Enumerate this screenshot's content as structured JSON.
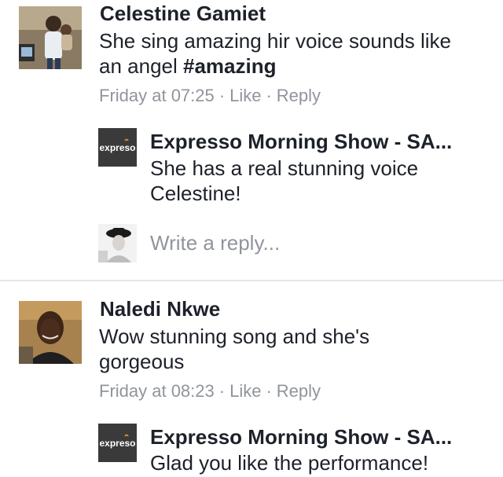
{
  "comments": [
    {
      "author": "Celestine Gamiet",
      "text_plain": "She sing amazing hir voice sounds like an angel ",
      "hashtag": "#amazing",
      "time": "Friday at 07:25",
      "like_label": "Like",
      "reply_label": "Reply",
      "reply": {
        "author": "Expresso Morning Show - SA...",
        "text": "She has a real stunning voice Celestine!",
        "avatar_logo_text": "expresso"
      },
      "write_reply_placeholder": "Write a reply..."
    },
    {
      "author": "Naledi Nkwe",
      "text_plain": "Wow stunning song and she's gorgeous",
      "time": "Friday at 08:23",
      "like_label": "Like",
      "reply_label": "Reply",
      "reply": {
        "author": "Expresso Morning Show - SA...",
        "text": "Glad you like the performance!",
        "avatar_logo_text": "expresso"
      }
    }
  ],
  "separator": "·",
  "colors": {
    "text": "#1d2129",
    "meta": "#90949c",
    "divider": "#e5e6e9",
    "logo_bg": "#3a3a3a",
    "logo_accent": "#e8a31c"
  }
}
